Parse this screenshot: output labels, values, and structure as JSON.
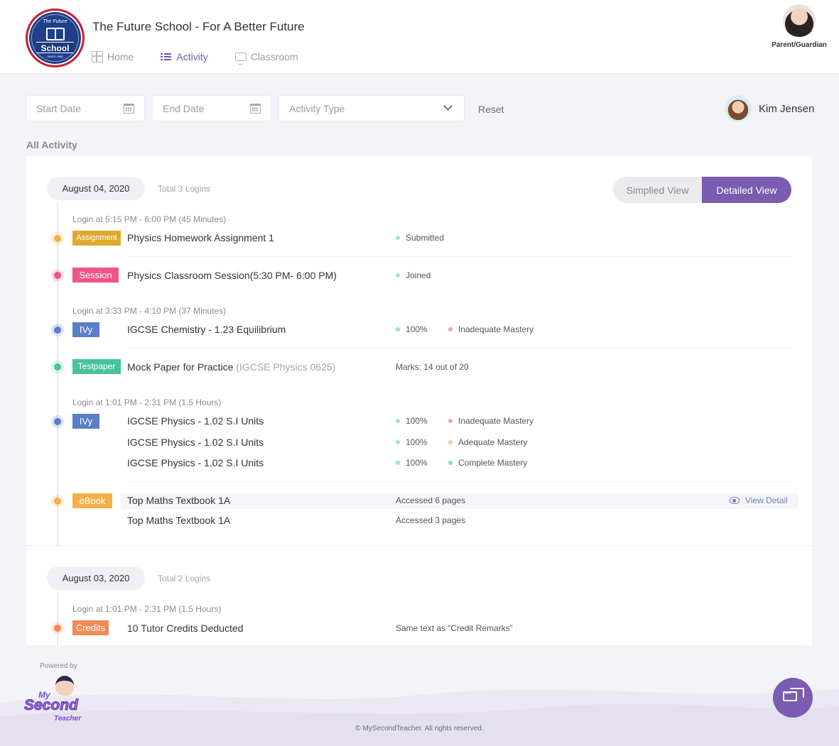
{
  "header": {
    "school_title": "The Future School - For A Better Future",
    "logo": {
      "top_text": "The Future",
      "word": "School",
      "since": "SINCE 1985"
    },
    "nav": [
      {
        "label": "Home",
        "icon": "grid-icon"
      },
      {
        "label": "Activity",
        "icon": "list-icon"
      },
      {
        "label": "Classroom",
        "icon": "monitor-icon"
      }
    ],
    "parent_label": "Parent/Guardian"
  },
  "filters": {
    "start_date_placeholder": "Start Date",
    "end_date_placeholder": "End Date",
    "activity_type_placeholder": "Activity Type",
    "reset_label": "Reset"
  },
  "user": {
    "name": "Kim Jensen"
  },
  "section_title": "All Activity",
  "view_toggle": {
    "simplified": "Simplied View",
    "detailed": "Detailed View",
    "selected": "Detailed View"
  },
  "days": [
    {
      "date": "August 04, 2020",
      "logins": "Total 3 Logins",
      "login_sessions": [
        "Login at 5:15 PM - 6:00 PM (45 Minutes)",
        "Login at 3:33 PM - 4:10 PM (37 Minutes)",
        "Login at 1:01 PM - 2:31 PM (1.5 Hours)"
      ],
      "activities": [
        {
          "tag": "Assignment",
          "tag_color": "#e0a92d",
          "title": "Physics Homework Assignment 1",
          "status": "Submitted",
          "status_color": "#5fcf9f"
        },
        {
          "tag": "Session",
          "tag_color": "#ee5583",
          "title": "Physics Classroom Session(5:30 PM- 6:00 PM)",
          "status": "Joined",
          "status_color": "#5fcf9f"
        },
        {
          "tag": "IVy",
          "tag_color": "#5b7ec9",
          "title": "IGCSE Chemistry - 1.23 Equilibrium",
          "score": "100%",
          "mastery": "Inadequate Mastery",
          "mastery_color": "#f0a4b5"
        },
        {
          "tag": "Testpaper",
          "tag_color": "#47c2a0",
          "title": "Mock Paper for Practice",
          "subtitle": "(IGCSE Physics 0625)",
          "status": "Marks: 14 out of 20"
        },
        {
          "tag": "IVy",
          "tag_color": "#5b7ec9",
          "items": [
            {
              "title": "IGCSE Physics - 1.02 S.I Units",
              "score": "100%",
              "mastery": "Inadequate Mastery",
              "mastery_color": "#f0a4b5"
            },
            {
              "title": "IGCSE Physics - 1.02 S.I Units",
              "score": "100%",
              "mastery": "Adequate Mastery",
              "mastery_color": "#f5c6a0"
            },
            {
              "title": "IGCSE Physics - 1.02 S.I Units",
              "score": "100%",
              "mastery": "Complete Mastery",
              "mastery_color": "#8fdcc0"
            }
          ]
        },
        {
          "tag": "eBook",
          "tag_color": "#f6b04a",
          "items": [
            {
              "title": "Top Maths Textbook 1A",
              "status": "Accessed 6 pages"
            },
            {
              "title": "Top Maths Textbook 1A",
              "status": "Accessed 3 pages"
            }
          ],
          "view_detail": "View Detail"
        }
      ]
    },
    {
      "date": "August 03, 2020",
      "logins": "Total 2 Logins",
      "login_sessions": [
        "Login at 1:01 PM - 2:31 PM (1.5 Hours)"
      ],
      "activities": [
        {
          "tag": "Credits",
          "tag_color": "#f28a55",
          "title": "10 Tutor Credits Deducted",
          "status": "Same text as “Credit Remarks”"
        }
      ]
    }
  ],
  "dot_colors": [
    "#f6b04a",
    "#ee5583",
    "#5b7ec9",
    "#47c2a0",
    "#5b7ec9",
    "#f6b04a",
    "#f28a55"
  ],
  "footer": {
    "powered_by": "Powered by",
    "brand": {
      "my": "My",
      "second": "Second",
      "teacher": "Teacher"
    },
    "copyright": "© MySecondTeacher. All rights reserved."
  },
  "chat_button_icon": "chat-bubbles-icon"
}
